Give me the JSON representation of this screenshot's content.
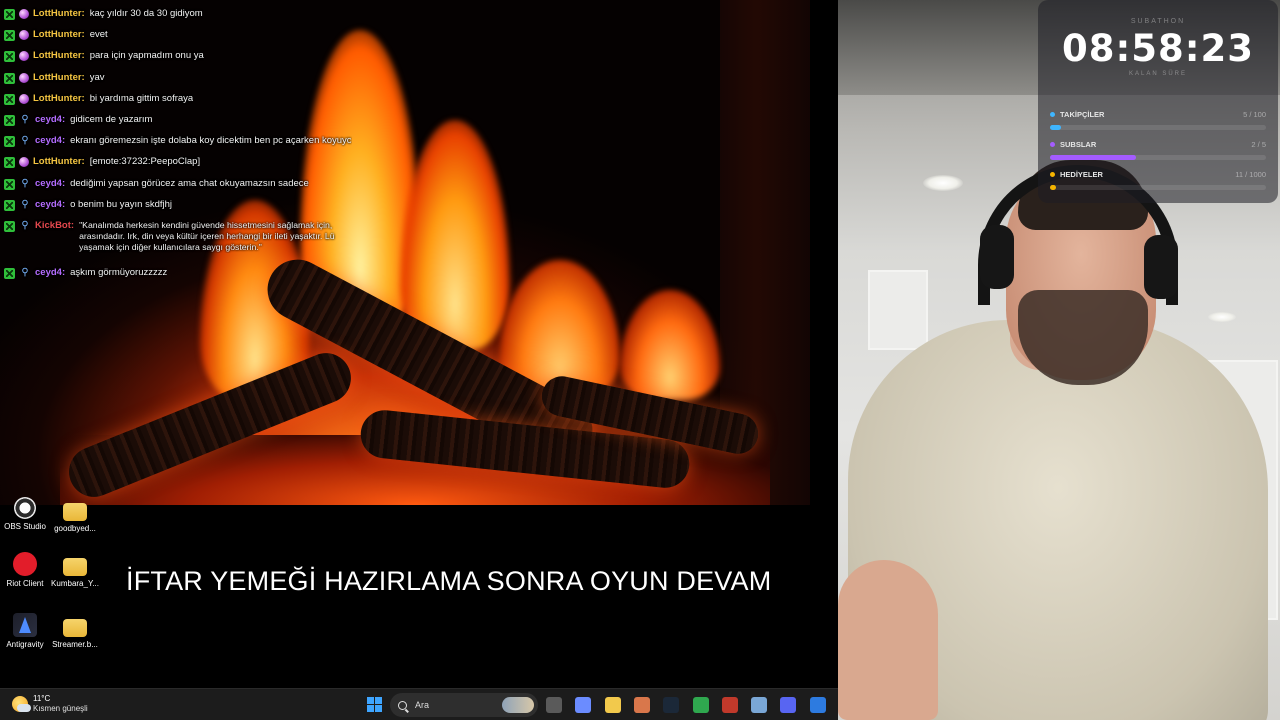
{
  "chat": {
    "messages": [
      {
        "user": "LottHunter",
        "user_color": "#f5c542",
        "badge": "sub",
        "text": "kaç yıldır 30 da 30 gidiyom"
      },
      {
        "user": "LottHunter",
        "user_color": "#f5c542",
        "badge": "sub",
        "text": "evet"
      },
      {
        "user": "LottHunter",
        "user_color": "#f5c542",
        "badge": "sub",
        "text": "para için yapmadım onu ya"
      },
      {
        "user": "LottHunter",
        "user_color": "#f5c542",
        "badge": "sub",
        "text": "yav"
      },
      {
        "user": "LottHunter",
        "user_color": "#f5c542",
        "badge": "sub",
        "text": "bi yardıma gittim sofraya"
      },
      {
        "user": "ceyd4",
        "user_color": "#b46cff",
        "badge": "link",
        "text": "gidicem de yazarım"
      },
      {
        "user": "ceyd4",
        "user_color": "#b46cff",
        "badge": "link",
        "text": "ekranı göremezsin işte dolaba koy dicektim ben pc açarken koyuyc"
      },
      {
        "user": "LottHunter",
        "user_color": "#f5c542",
        "badge": "sub",
        "text": "[emote:37232:PeepoClap]"
      },
      {
        "user": "ceyd4",
        "user_color": "#b46cff",
        "badge": "link",
        "text": "dediğimi yapsan görücez ama chat okuyamazsın sadece"
      },
      {
        "user": "ceyd4",
        "user_color": "#b46cff",
        "badge": "link",
        "text": "o benim bu yayın skdfjhj"
      },
      {
        "user": "KickBot",
        "user_color": "#e5484d",
        "badge": "link",
        "text": "\"Kanalımda herkesin kendini güvende hissetmesini sağlamak için, arasındadır. Irk, din veya kültür içeren herhangi bir ileti yaşaktır. Lü yaşamak için diğer kullanıcılara saygı gösterin.\"",
        "tall": true
      },
      {
        "user": "ceyd4",
        "user_color": "#b46cff",
        "badge": "link",
        "text": "aşkım görmüyoruzzzzz"
      }
    ]
  },
  "desktop_icons": [
    {
      "label": "OBS Studio",
      "icon": "obs-icon"
    },
    {
      "label": "goodbyed...",
      "icon": "folder-icon"
    },
    {
      "label": "Riot Client",
      "icon": "riot-icon"
    },
    {
      "label": "Kumbara_Y...",
      "icon": "folder-icon"
    },
    {
      "label": "Antigravity",
      "icon": "antigravity-icon"
    },
    {
      "label": "Streamer.b...",
      "icon": "folder-icon"
    }
  ],
  "overlay_text": "İFTAR YEMEĞİ HAZIRLAMA SONRA OYUN DEVAM",
  "subathon": {
    "title": "SUBATHON",
    "timer": "08:58:23",
    "caption": "KALAN SÜRE",
    "goals": [
      {
        "name": "TAKİPÇİLER",
        "count": "5 / 100",
        "progress": 0.05,
        "color": "#3fb6ff"
      },
      {
        "name": "SUBSLAR",
        "count": "2 / 5",
        "progress": 0.4,
        "color": "#a45cff"
      },
      {
        "name": "HEDİYELER",
        "count": "11 / 1000",
        "progress": 0.011,
        "color": "#f5b400"
      }
    ]
  },
  "taskbar": {
    "weather_temp": "11°C",
    "weather_condition": "Kısmen güneşli",
    "search_placeholder": "Ara",
    "apps": [
      "task-view-icon",
      "copilot-icon",
      "file-explorer-icon",
      "claude-icon",
      "steam-icon",
      "chrome-icon",
      "obs-icon",
      "valorant-icon",
      "discord-icon",
      "app-icon"
    ]
  }
}
